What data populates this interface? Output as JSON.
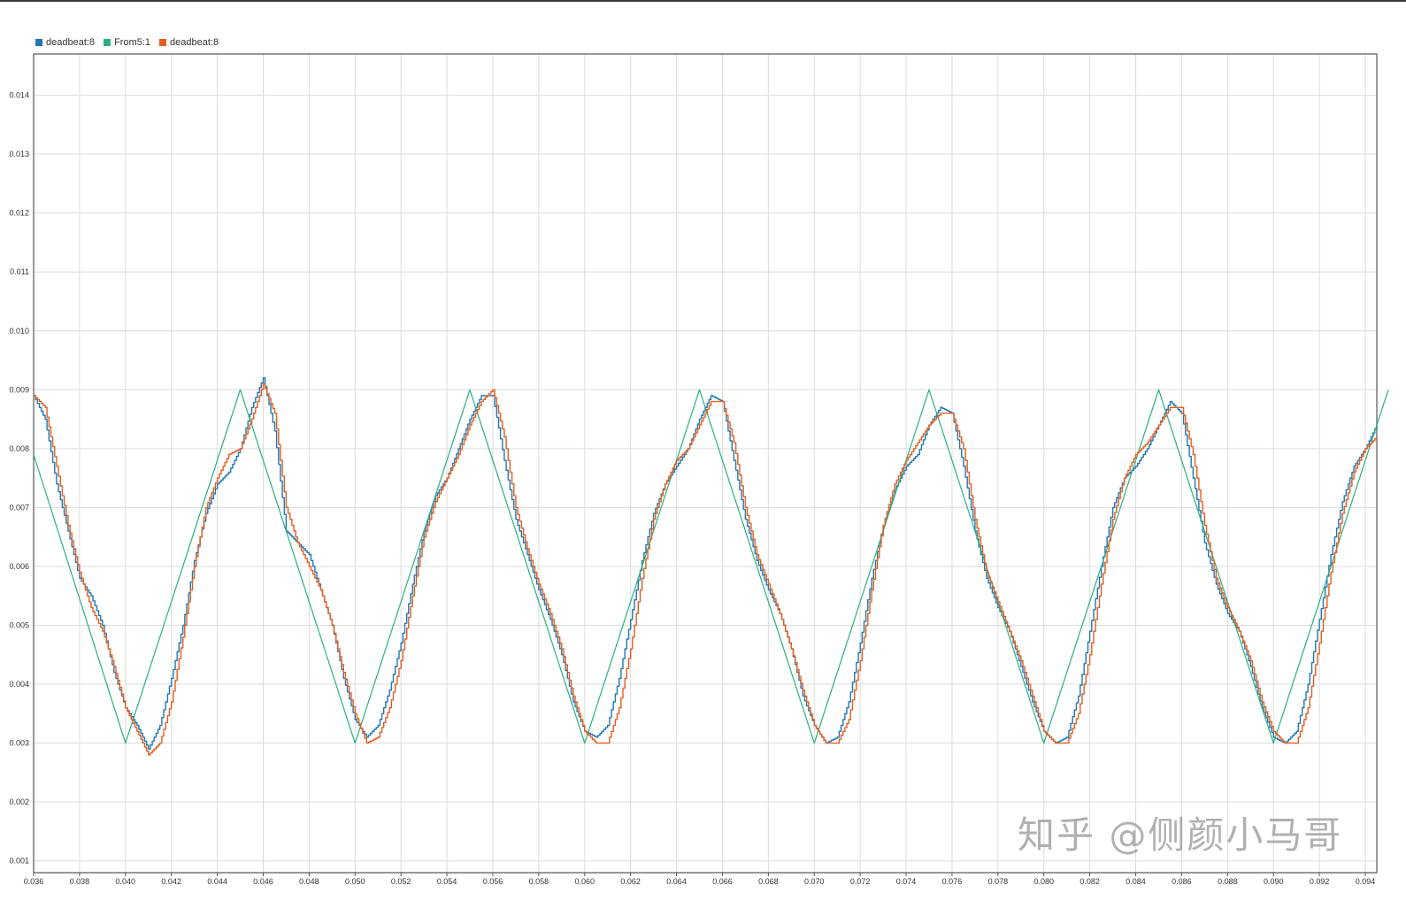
{
  "legend": [
    {
      "label": "deadbeat:8",
      "color": "#1f77b4"
    },
    {
      "label": "From5:1",
      "color": "#2ab07f"
    },
    {
      "label": "deadbeat:8",
      "color": "#e35d1f"
    }
  ],
  "watermark": "知乎 @侧颜小马哥",
  "chart_data": {
    "type": "line",
    "title": "",
    "xlabel": "",
    "ylabel": "",
    "xlim": [
      0.036,
      0.0945
    ],
    "ylim": [
      0.0008,
      0.0147
    ],
    "grid": true,
    "legend_position": "top-left",
    "x_ticks": [
      "0.036",
      "0.038",
      "0.040",
      "0.042",
      "0.044",
      "0.046",
      "0.048",
      "0.050",
      "0.052",
      "0.054",
      "0.056",
      "0.058",
      "0.060",
      "0.062",
      "0.064",
      "0.066",
      "0.068",
      "0.070",
      "0.072",
      "0.074",
      "0.076",
      "0.078",
      "0.080",
      "0.082",
      "0.084",
      "0.086",
      "0.088",
      "0.090",
      "0.092",
      "0.094"
    ],
    "y_ticks": [
      "0.001",
      "0.002",
      "0.003",
      "0.004",
      "0.005",
      "0.006",
      "0.007",
      "0.008",
      "0.009",
      "0.010",
      "0.011",
      "0.012",
      "0.013",
      "0.014"
    ],
    "series": [
      {
        "name": "deadbeat:8",
        "color": "#1f77b4",
        "x": [
          0.036,
          0.0365,
          0.037,
          0.0375,
          0.038,
          0.0385,
          0.039,
          0.0395,
          0.04,
          0.0405,
          0.041,
          0.0415,
          0.042,
          0.0425,
          0.043,
          0.0435,
          0.044,
          0.0445,
          0.045,
          0.0455,
          0.046,
          0.0465,
          0.047,
          0.0475,
          0.048,
          0.0485,
          0.049,
          0.0495,
          0.05,
          0.0505,
          0.051,
          0.0515,
          0.052,
          0.0525,
          0.053,
          0.0535,
          0.054,
          0.0545,
          0.055,
          0.0555,
          0.056,
          0.0565,
          0.057,
          0.0575,
          0.058,
          0.0585,
          0.059,
          0.0595,
          0.06,
          0.0605,
          0.061,
          0.0615,
          0.062,
          0.0625,
          0.063,
          0.0635,
          0.064,
          0.0645,
          0.065,
          0.0655,
          0.066,
          0.0665,
          0.067,
          0.0675,
          0.068,
          0.0685,
          0.069,
          0.0695,
          0.07,
          0.0705,
          0.071,
          0.0715,
          0.072,
          0.0725,
          0.073,
          0.0735,
          0.074,
          0.0745,
          0.075,
          0.0755,
          0.076,
          0.0765,
          0.077,
          0.0775,
          0.078,
          0.0785,
          0.079,
          0.0795,
          0.08,
          0.0805,
          0.081,
          0.0815,
          0.082,
          0.0825,
          0.083,
          0.0835,
          0.084,
          0.0845,
          0.085,
          0.0855,
          0.086,
          0.0865,
          0.087,
          0.0875,
          0.088,
          0.0885,
          0.089,
          0.0895,
          0.09,
          0.0905,
          0.091,
          0.0915,
          0.092,
          0.0925,
          0.093,
          0.0935,
          0.094,
          0.0945
        ],
        "y": [
          0.0089,
          0.0085,
          0.0074,
          0.0066,
          0.0058,
          0.0055,
          0.005,
          0.0042,
          0.0036,
          0.0033,
          0.0029,
          0.0033,
          0.0041,
          0.005,
          0.0061,
          0.0069,
          0.0074,
          0.0076,
          0.008,
          0.0087,
          0.0092,
          0.0083,
          0.0066,
          0.0064,
          0.0062,
          0.0056,
          0.005,
          0.0041,
          0.0034,
          0.0031,
          0.0033,
          0.0039,
          0.0047,
          0.0057,
          0.0066,
          0.0072,
          0.0075,
          0.008,
          0.0085,
          0.0089,
          0.0089,
          0.0078,
          0.0068,
          0.0062,
          0.0056,
          0.0051,
          0.0045,
          0.0037,
          0.0032,
          0.0031,
          0.0033,
          0.0041,
          0.0051,
          0.0061,
          0.0069,
          0.0074,
          0.0077,
          0.008,
          0.0085,
          0.0089,
          0.0088,
          0.0078,
          0.0068,
          0.0061,
          0.0056,
          0.0052,
          0.0046,
          0.0038,
          0.0033,
          0.003,
          0.0031,
          0.0037,
          0.0047,
          0.0058,
          0.0067,
          0.0073,
          0.0077,
          0.0079,
          0.0084,
          0.0087,
          0.0086,
          0.0077,
          0.0066,
          0.0058,
          0.0053,
          0.0049,
          0.0043,
          0.0037,
          0.0032,
          0.003,
          0.0031,
          0.0038,
          0.0049,
          0.006,
          0.007,
          0.0075,
          0.0077,
          0.008,
          0.0084,
          0.0088,
          0.0086,
          0.0075,
          0.0064,
          0.0057,
          0.0052,
          0.0049,
          0.0043,
          0.0036,
          0.0031,
          0.003,
          0.0032,
          0.004,
          0.0051,
          0.0062,
          0.0071,
          0.0077,
          0.008,
          0.0084
        ]
      },
      {
        "name": "From5:1",
        "color": "#2ab07f",
        "x": [
          0.036,
          0.04,
          0.045,
          0.05,
          0.055,
          0.06,
          0.065,
          0.07,
          0.075,
          0.08,
          0.085,
          0.09,
          0.095
        ],
        "y": [
          0.0079,
          0.003,
          0.009,
          0.003,
          0.009,
          0.003,
          0.009,
          0.003,
          0.009,
          0.003,
          0.009,
          0.003,
          0.009
        ]
      },
      {
        "name": "deadbeat:8",
        "color": "#e35d1f",
        "x": [
          0.036,
          0.0365,
          0.037,
          0.0375,
          0.038,
          0.0385,
          0.039,
          0.0395,
          0.04,
          0.0405,
          0.041,
          0.0415,
          0.042,
          0.0425,
          0.043,
          0.0435,
          0.044,
          0.0445,
          0.045,
          0.0455,
          0.046,
          0.0465,
          0.047,
          0.0475,
          0.048,
          0.0485,
          0.049,
          0.0495,
          0.05,
          0.0505,
          0.051,
          0.0515,
          0.052,
          0.0525,
          0.053,
          0.0535,
          0.054,
          0.0545,
          0.055,
          0.0555,
          0.056,
          0.0565,
          0.057,
          0.0575,
          0.058,
          0.0585,
          0.059,
          0.0595,
          0.06,
          0.0605,
          0.061,
          0.0615,
          0.062,
          0.0625,
          0.063,
          0.0635,
          0.064,
          0.0645,
          0.065,
          0.0655,
          0.066,
          0.0665,
          0.067,
          0.0675,
          0.068,
          0.0685,
          0.069,
          0.0695,
          0.07,
          0.0705,
          0.071,
          0.0715,
          0.072,
          0.0725,
          0.073,
          0.0735,
          0.074,
          0.0745,
          0.075,
          0.0755,
          0.076,
          0.0765,
          0.077,
          0.0775,
          0.078,
          0.0785,
          0.079,
          0.0795,
          0.08,
          0.0805,
          0.081,
          0.0815,
          0.082,
          0.0825,
          0.083,
          0.0835,
          0.084,
          0.0845,
          0.085,
          0.0855,
          0.086,
          0.0865,
          0.087,
          0.0875,
          0.088,
          0.0885,
          0.089,
          0.0895,
          0.09,
          0.0905,
          0.091,
          0.0915,
          0.092,
          0.0925,
          0.093,
          0.0935,
          0.094,
          0.0945
        ],
        "y": [
          0.0089,
          0.0087,
          0.0077,
          0.0067,
          0.0059,
          0.0053,
          0.0049,
          0.0043,
          0.0036,
          0.0032,
          0.0028,
          0.003,
          0.0037,
          0.0048,
          0.006,
          0.007,
          0.0075,
          0.0079,
          0.008,
          0.0085,
          0.0091,
          0.0086,
          0.007,
          0.0064,
          0.006,
          0.0056,
          0.005,
          0.0042,
          0.0035,
          0.003,
          0.0031,
          0.0036,
          0.0044,
          0.0055,
          0.0065,
          0.0071,
          0.0075,
          0.0079,
          0.0084,
          0.0088,
          0.009,
          0.0082,
          0.007,
          0.0063,
          0.0057,
          0.0052,
          0.0046,
          0.0038,
          0.0032,
          0.003,
          0.003,
          0.0036,
          0.0046,
          0.0058,
          0.0068,
          0.0074,
          0.0078,
          0.008,
          0.0084,
          0.0088,
          0.0088,
          0.0081,
          0.007,
          0.0062,
          0.0057,
          0.0052,
          0.0046,
          0.0039,
          0.0033,
          0.003,
          0.003,
          0.0034,
          0.0044,
          0.0056,
          0.0067,
          0.0074,
          0.0078,
          0.0081,
          0.0084,
          0.0086,
          0.0086,
          0.008,
          0.0068,
          0.0059,
          0.0054,
          0.0049,
          0.0044,
          0.0038,
          0.0032,
          0.003,
          0.003,
          0.0035,
          0.0045,
          0.0057,
          0.0068,
          0.0075,
          0.0079,
          0.0081,
          0.0084,
          0.0087,
          0.0087,
          0.0079,
          0.0067,
          0.0058,
          0.0053,
          0.0049,
          0.0044,
          0.0037,
          0.0032,
          0.003,
          0.003,
          0.0036,
          0.0047,
          0.0059,
          0.0069,
          0.0076,
          0.008,
          0.0082
        ]
      }
    ]
  }
}
